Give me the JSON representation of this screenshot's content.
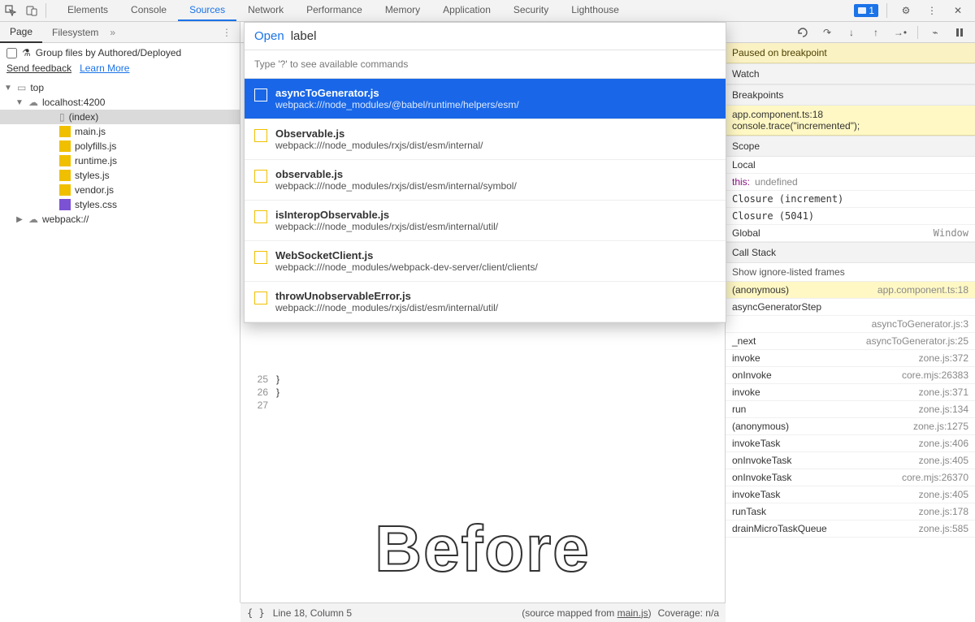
{
  "topTabs": [
    "Elements",
    "Console",
    "Sources",
    "Network",
    "Performance",
    "Memory",
    "Application",
    "Security",
    "Lighthouse"
  ],
  "topActiveIndex": 2,
  "issuesCount": "1",
  "pageTabs": {
    "items": [
      "Page",
      "Filesystem"
    ],
    "activeIndex": 0
  },
  "groupFiles": {
    "label": "Group files by Authored/Deployed"
  },
  "feedback": {
    "send": "Send feedback",
    "learn": "Learn More"
  },
  "tree": {
    "top": "top",
    "host": "localhost:4200",
    "files": [
      "(index)",
      "main.js",
      "polyfills.js",
      "runtime.js",
      "styles.js",
      "vendor.js",
      "styles.css"
    ],
    "webpack": "webpack://",
    "selectedIndex": 0
  },
  "quickOpen": {
    "prefix": "Open",
    "query": "label",
    "hint": "Type '?' to see available commands",
    "items": [
      {
        "title": "asyncToGenerator.js",
        "path": "webpack:///node_modules/@babel/runtime/helpers/esm/"
      },
      {
        "title": "Observable.js",
        "path": "webpack:///node_modules/rxjs/dist/esm/internal/"
      },
      {
        "title": "observable.js",
        "path": "webpack:///node_modules/rxjs/dist/esm/internal/symbol/"
      },
      {
        "title": "isInteropObservable.js",
        "path": "webpack:///node_modules/rxjs/dist/esm/internal/util/"
      },
      {
        "title": "WebSocketClient.js",
        "path": "webpack:///node_modules/webpack-dev-server/client/clients/"
      },
      {
        "title": "throwUnobservableError.js",
        "path": "webpack:///node_modules/rxjs/dist/esm/internal/util/"
      }
    ],
    "selectedIndex": 0
  },
  "code": {
    "lines": [
      {
        "n": "25",
        "t": "  }"
      },
      {
        "n": "26",
        "t": "}"
      },
      {
        "n": "27",
        "t": ""
      }
    ]
  },
  "watermark": "Before",
  "footer": {
    "pretty": "{ }",
    "pos": "Line 18, Column 5",
    "mapPrefix": "(source mapped from ",
    "mapFile": "main.js",
    "mapSuffix": ")",
    "coverage": "Coverage: n/a"
  },
  "debugger": {
    "paused": "Paused on breakpoint",
    "sections": {
      "watch": "Watch",
      "breakpoints": "Breakpoints",
      "scope": "Scope",
      "callstack": "Call Stack"
    },
    "breakpoint": {
      "loc": "app.component.ts:18",
      "code": "console.trace(\"incremented\");"
    },
    "scope": {
      "local": "Local",
      "localRows": [
        {
          "k": "this:",
          "v": "undefined"
        }
      ],
      "closures": [
        "Closure (increment)",
        "Closure (5041)"
      ],
      "global": "Global",
      "globalType": "Window"
    },
    "ignore": "Show ignore-listed frames",
    "stack": [
      {
        "fn": "(anonymous)",
        "loc": "app.component.ts:18",
        "hl": true
      },
      {
        "fn": "asyncGeneratorStep",
        "loc": ""
      },
      {
        "fn": "",
        "loc": "asyncToGenerator.js:3"
      },
      {
        "fn": "_next",
        "loc": "asyncToGenerator.js:25"
      },
      {
        "fn": "invoke",
        "loc": "zone.js:372"
      },
      {
        "fn": "onInvoke",
        "loc": "core.mjs:26383"
      },
      {
        "fn": "invoke",
        "loc": "zone.js:371"
      },
      {
        "fn": "run",
        "loc": "zone.js:134"
      },
      {
        "fn": "(anonymous)",
        "loc": "zone.js:1275"
      },
      {
        "fn": "invokeTask",
        "loc": "zone.js:406"
      },
      {
        "fn": "onInvokeTask",
        "loc": "zone.js:405"
      },
      {
        "fn": "onInvokeTask",
        "loc": "core.mjs:26370"
      },
      {
        "fn": "invokeTask",
        "loc": "zone.js:405"
      },
      {
        "fn": "runTask",
        "loc": "zone.js:178"
      },
      {
        "fn": "drainMicroTaskQueue",
        "loc": "zone.js:585"
      }
    ]
  }
}
